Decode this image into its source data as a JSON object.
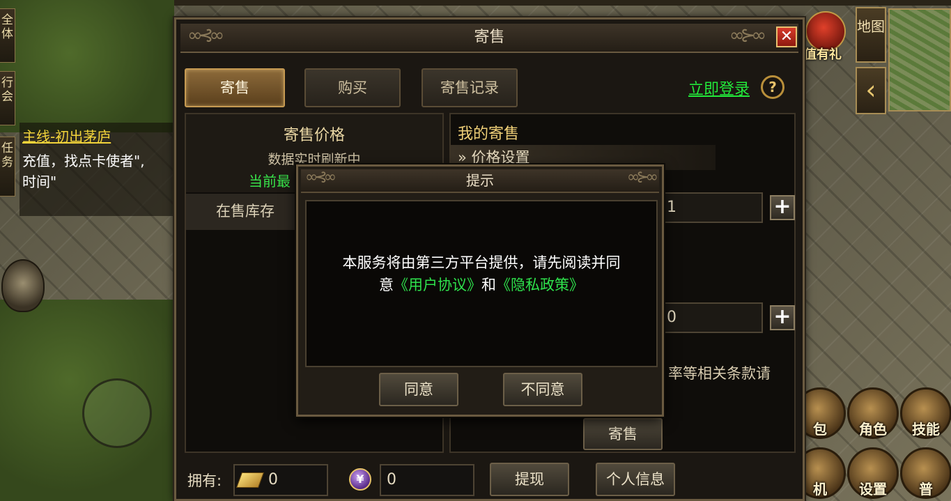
{
  "scene": {
    "left_tabs": [
      "全体",
      "行会",
      "任务"
    ],
    "quest": {
      "title": "主线-初出茅庐",
      "text_line1": "充值，找点卡使者\",",
      "text_line2": "时间\""
    },
    "map_button": "地图",
    "gift_label": "值有礼",
    "round_buttons": [
      "包",
      "角色",
      "技能",
      "机",
      "设置",
      "普"
    ]
  },
  "panel": {
    "title": "寄售",
    "close": "✕",
    "tabs": [
      {
        "label": "寄售",
        "active": true
      },
      {
        "label": "购买",
        "active": false
      },
      {
        "label": "寄售记录",
        "active": false
      }
    ],
    "login_link": "立即登录",
    "help": "?",
    "left": {
      "title": "寄售价格",
      "subtitle": "数据实时刷新中",
      "green_text": "当前最",
      "row_label": "在售库存"
    },
    "right": {
      "title": "我的寄售",
      "subtitle": "» 价格设置",
      "input1_value": "1",
      "input2_value": "0",
      "clause_text": "率等相关条款请",
      "sell_button": "寄售",
      "plus": "+"
    },
    "bottom": {
      "own_label": "拥有:",
      "gold_value": "0",
      "coin_value": "0",
      "coin_symbol": "¥",
      "withdraw_button": "提现",
      "profile_button": "个人信息"
    }
  },
  "modal": {
    "title": "提示",
    "message_line1": "本服务将由第三方平台提供，请先阅读并同",
    "message_prefix": "意",
    "link_agreement": "《用户协议》",
    "message_and": "和",
    "link_privacy": "《隐私政策》",
    "agree_button": "同意",
    "disagree_button": "不同意"
  }
}
